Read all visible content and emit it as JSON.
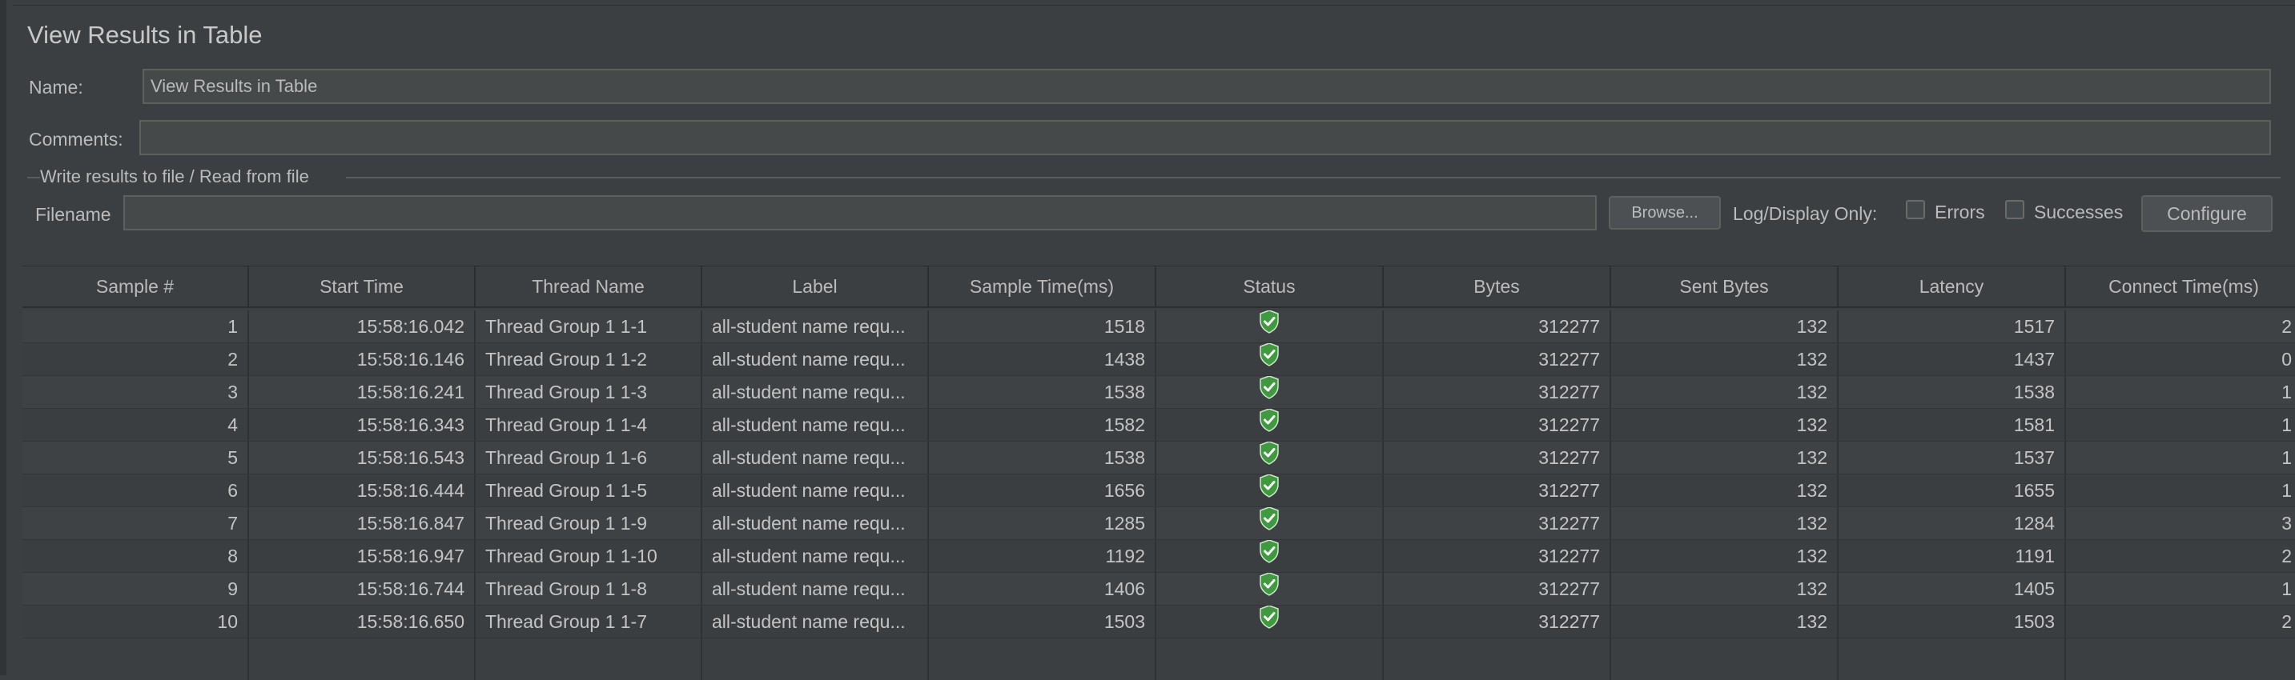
{
  "window": {
    "title": "View Results in Table"
  },
  "form": {
    "name_label": "Name:",
    "name_value": "View Results in Table",
    "comments_label": "Comments:",
    "comments_value": "",
    "file_section_title": "Write results to file / Read from file",
    "filename_label": "Filename",
    "filename_value": "",
    "browse_label": "Browse...",
    "log_display_label": "Log/Display Only:",
    "errors_label": "Errors",
    "errors_checked": false,
    "successes_label": "Successes",
    "successes_checked": false,
    "configure_label": "Configure"
  },
  "table": {
    "columns": [
      "Sample #",
      "Start Time",
      "Thread Name",
      "Label",
      "Sample Time(ms)",
      "Status",
      "Bytes",
      "Sent Bytes",
      "Latency",
      "Connect Time(ms)"
    ],
    "rows": [
      [
        "1",
        "15:58:16.042",
        "Thread Group 1 1-1",
        "all-student name requ...",
        "1518",
        "success",
        "312277",
        "132",
        "1517",
        "2"
      ],
      [
        "2",
        "15:58:16.146",
        "Thread Group 1 1-2",
        "all-student name requ...",
        "1438",
        "success",
        "312277",
        "132",
        "1437",
        "0"
      ],
      [
        "3",
        "15:58:16.241",
        "Thread Group 1 1-3",
        "all-student name requ...",
        "1538",
        "success",
        "312277",
        "132",
        "1538",
        "1"
      ],
      [
        "4",
        "15:58:16.343",
        "Thread Group 1 1-4",
        "all-student name requ...",
        "1582",
        "success",
        "312277",
        "132",
        "1581",
        "1"
      ],
      [
        "5",
        "15:58:16.543",
        "Thread Group 1 1-6",
        "all-student name requ...",
        "1538",
        "success",
        "312277",
        "132",
        "1537",
        "1"
      ],
      [
        "6",
        "15:58:16.444",
        "Thread Group 1 1-5",
        "all-student name requ...",
        "1656",
        "success",
        "312277",
        "132",
        "1655",
        "1"
      ],
      [
        "7",
        "15:58:16.847",
        "Thread Group 1 1-9",
        "all-student name requ...",
        "1285",
        "success",
        "312277",
        "132",
        "1284",
        "3"
      ],
      [
        "8",
        "15:58:16.947",
        "Thread Group 1 1-10",
        "all-student name requ...",
        "1192",
        "success",
        "312277",
        "132",
        "1191",
        "2"
      ],
      [
        "9",
        "15:58:16.744",
        "Thread Group 1 1-8",
        "all-student name requ...",
        "1406",
        "success",
        "312277",
        "132",
        "1405",
        "1"
      ],
      [
        "10",
        "15:58:16.650",
        "Thread Group 1 1-7",
        "all-student name requ...",
        "1503",
        "success",
        "312277",
        "132",
        "1503",
        "2"
      ]
    ],
    "status_icon": "success-shield-icon",
    "colors": {
      "success": "#4caf50"
    }
  }
}
